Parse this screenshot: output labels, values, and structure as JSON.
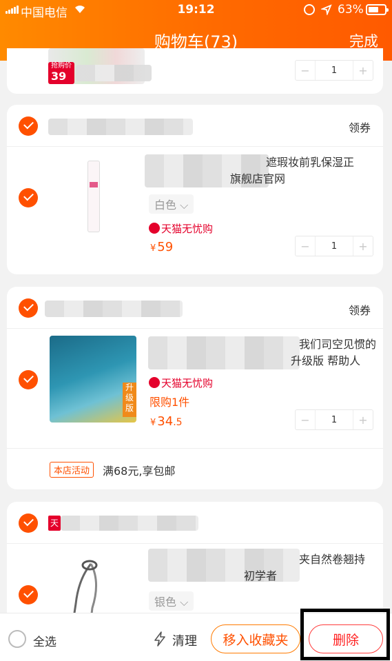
{
  "status_bar": {
    "carrier": "中国电信",
    "time": "19:12",
    "battery": "63%",
    "battery_level": 0.63
  },
  "nav": {
    "title": "购物车(73)",
    "done": "完成"
  },
  "items": [
    {
      "promo_badge": "抢购价",
      "promo_price": "39",
      "quantity": "1"
    },
    {
      "coupon": "领券",
      "title_line1": "遮瑕妆前乳保湿正",
      "title_line2": "旗舰店官网",
      "sku": "白色",
      "service": "天猫无忧购",
      "currency": "¥",
      "price": "59",
      "quantity": "1"
    },
    {
      "coupon": "领券",
      "title_line1": "我们司空见惯的",
      "title_line2": "升级版 帮助人",
      "thumb_badge": "升级版",
      "service": "天猫无忧购",
      "limit": "限购1件",
      "currency": "¥",
      "price_int": "34",
      "price_dec": ".5",
      "quantity": "1",
      "promo_tag": "本店活动",
      "promo_text": "满68元,享包邮"
    },
    {
      "shop_badge": "天",
      "title_line1": "夹自然卷翘持",
      "title_line2": "初学者",
      "sku": "银色"
    }
  ],
  "bottom": {
    "select_all": "全选",
    "clean": "清理",
    "move_to_favorites": "移入收藏夹",
    "delete": "删除"
  },
  "colors": {
    "accent": "#ff5000",
    "nav_start": "#ff8a00",
    "nav_end": "#ff5a00",
    "tmall_red": "#e4002b"
  }
}
